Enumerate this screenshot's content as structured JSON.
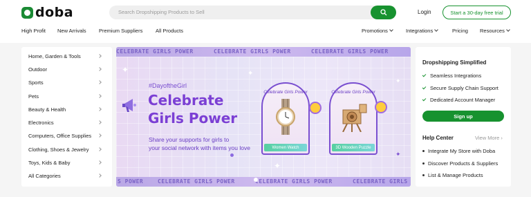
{
  "brand": {
    "name": "doba",
    "accent": "#17922f"
  },
  "search": {
    "placeholder": "Search Dropshipping Products to Sell",
    "icon": "search-icon"
  },
  "header": {
    "login": "Login",
    "trial": "Start a 30-day free trial"
  },
  "nav_left": [
    "High Profit",
    "New Arrivals",
    "Premium Suppliers",
    "All Products"
  ],
  "nav_right": [
    {
      "label": "Promotions",
      "dropdown": true
    },
    {
      "label": "Integrations",
      "dropdown": true
    },
    {
      "label": "Pricing",
      "dropdown": false
    },
    {
      "label": "Resources",
      "dropdown": true
    }
  ],
  "categories": [
    "Home, Garden & Tools",
    "Outdoor",
    "Sports",
    "Pets",
    "Beauty & Health",
    "Electronics",
    "Computers, Office Supplies",
    "Clothing, Shoes & Jewelry",
    "Toys, Kids & Baby",
    "All Categories"
  ],
  "banner": {
    "band_text": "CELEBRATE GIRLS POWER",
    "band_text_bottom_start": "S POWER",
    "hashtag": "#DayoftheGirl",
    "headline_1": "Celebrate",
    "headline_2": "Girls Power",
    "sub_1": "Share your supports for girls to",
    "sub_2": "your social network with items you love",
    "arch_title": "Celebrate Girls Power",
    "product_1": "Women Watch",
    "product_2": "3D Wooden Puzzle",
    "slide_dots": 2
  },
  "panel": {
    "title": "Dropshipping Simplified",
    "features": [
      "Seamless Integrations",
      "Secure Supply Chain Support",
      "Dedicated Account Manager"
    ],
    "signup": "Sign up",
    "help_title": "Help Center",
    "view_more": "View More",
    "help_items": [
      "Integrate My Store with Doba",
      "Discover Products & Suppliers",
      "List & Manage Products"
    ]
  }
}
